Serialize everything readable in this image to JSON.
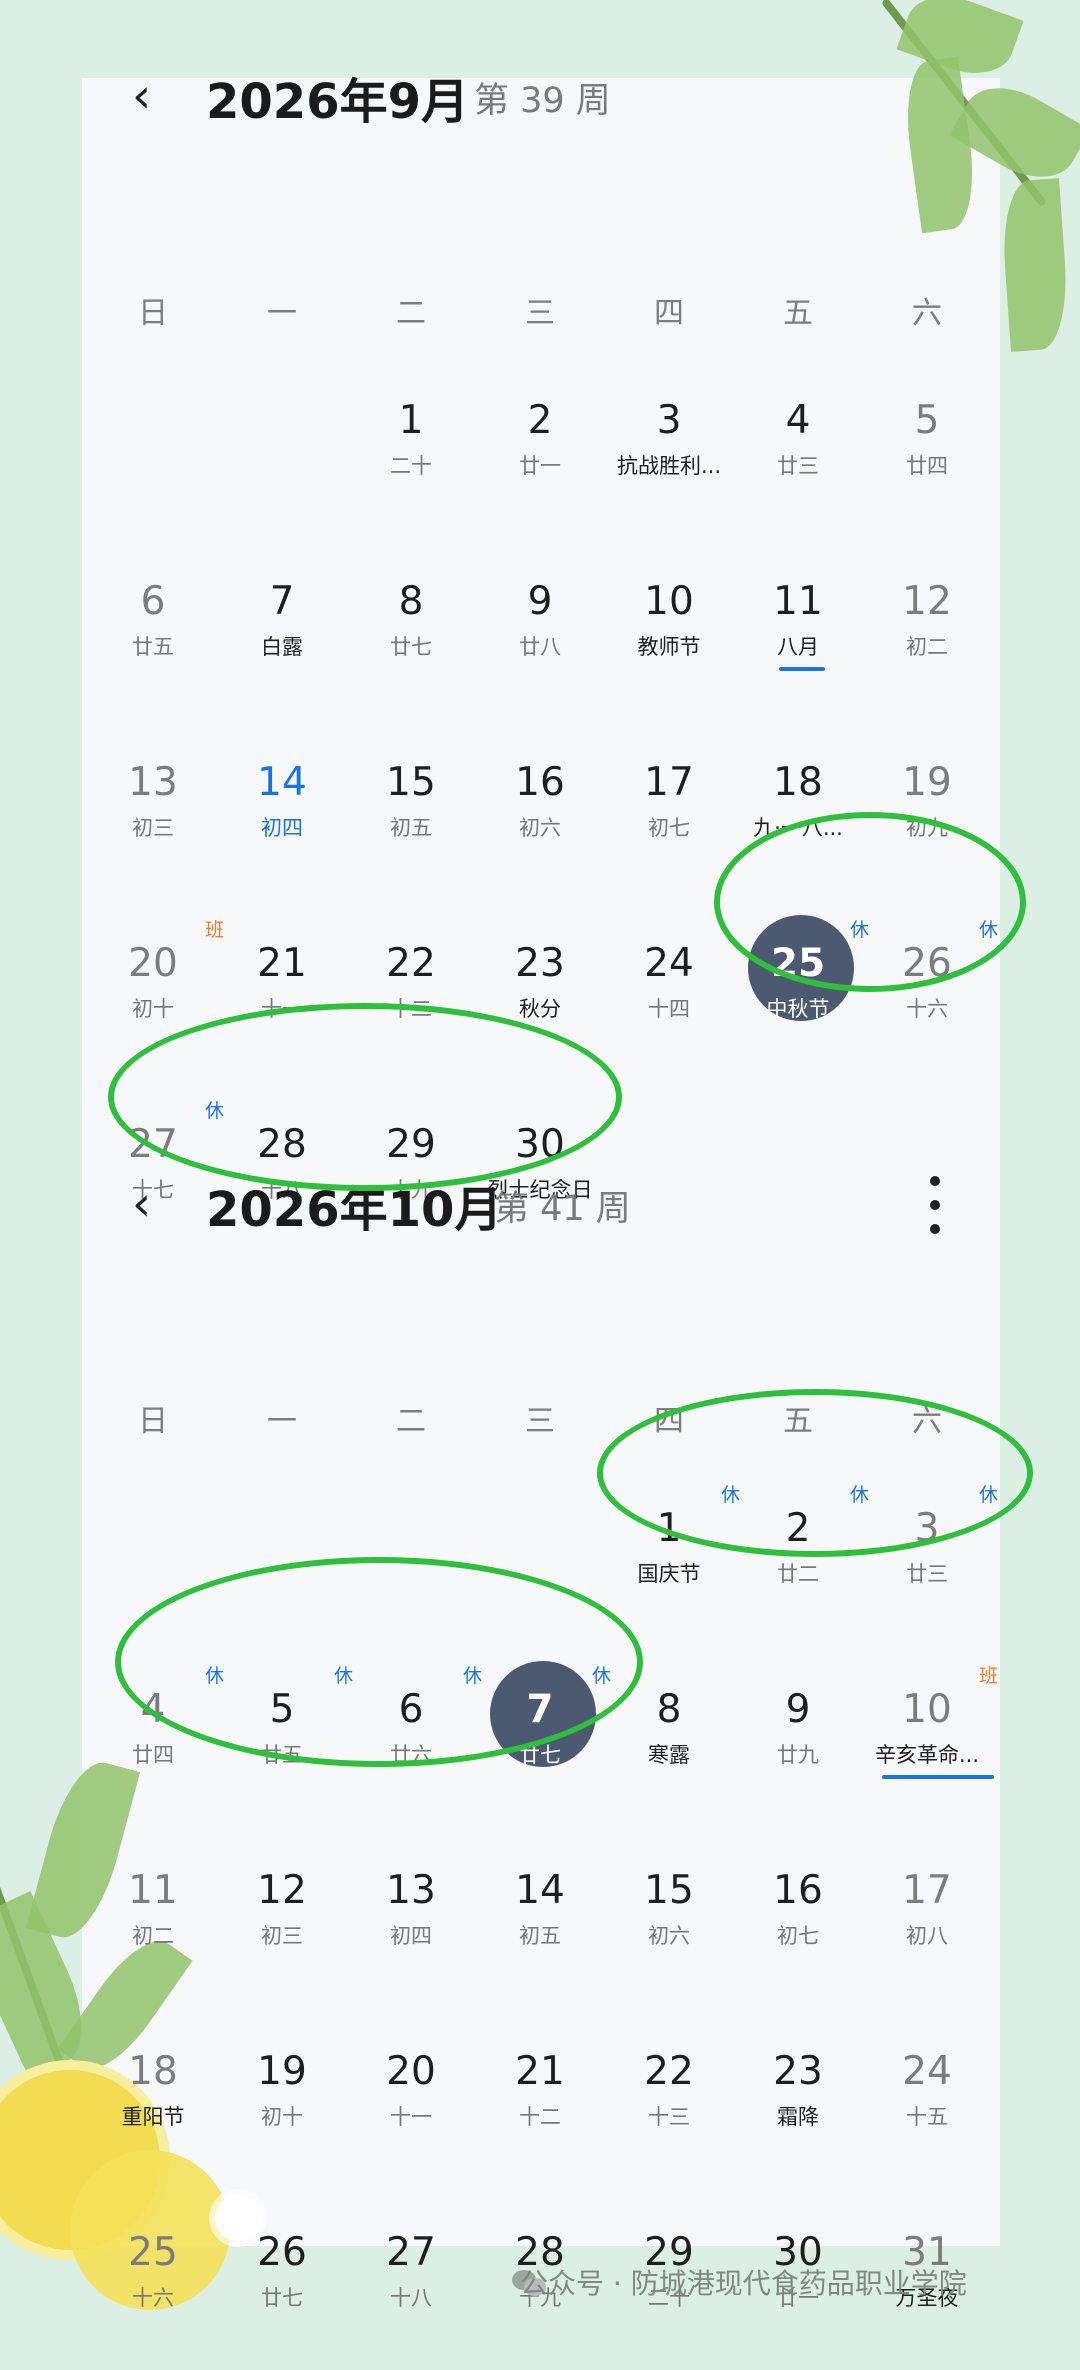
{
  "weekday_headers": [
    "日",
    "一",
    "二",
    "三",
    "四",
    "五",
    "六"
  ],
  "months": [
    {
      "title": "2026年9月",
      "week_label": "第 39 周",
      "show_more": false,
      "weeks": [
        [
          null,
          null,
          {
            "day": "1",
            "lunar": "二十"
          },
          {
            "day": "2",
            "lunar": "廿一"
          },
          {
            "day": "3",
            "lunar": "抗战胜利...",
            "lunar_dark": true
          },
          {
            "day": "4",
            "lunar": "廿三"
          },
          {
            "day": "5",
            "lunar": "廿四"
          }
        ],
        [
          {
            "day": "6",
            "lunar": "廿五"
          },
          {
            "day": "7",
            "lunar": "白露",
            "lunar_dark": true
          },
          {
            "day": "8",
            "lunar": "廿七"
          },
          {
            "day": "9",
            "lunar": "廿八"
          },
          {
            "day": "10",
            "lunar": "教师节",
            "lunar_dark": true
          },
          {
            "day": "11",
            "lunar": "八月",
            "lunar_dark": true,
            "underline": true
          },
          {
            "day": "12",
            "lunar": "初二"
          }
        ],
        [
          {
            "day": "13",
            "lunar": "初三"
          },
          {
            "day": "14",
            "lunar": "初四",
            "today": true
          },
          {
            "day": "15",
            "lunar": "初五"
          },
          {
            "day": "16",
            "lunar": "初六"
          },
          {
            "day": "17",
            "lunar": "初七"
          },
          {
            "day": "18",
            "lunar": "九·一八...",
            "lunar_dark": true
          },
          {
            "day": "19",
            "lunar": "初九"
          }
        ],
        [
          {
            "day": "20",
            "lunar": "初十",
            "badge": "班",
            "badge_type": "work"
          },
          {
            "day": "21",
            "lunar": "十一"
          },
          {
            "day": "22",
            "lunar": "十二"
          },
          {
            "day": "23",
            "lunar": "秋分",
            "lunar_dark": true
          },
          {
            "day": "24",
            "lunar": "十四"
          },
          {
            "day": "25",
            "lunar": "中秋节",
            "selected": true,
            "badge": "休",
            "badge_type": "rest"
          },
          {
            "day": "26",
            "lunar": "十六",
            "badge": "休",
            "badge_type": "rest"
          }
        ],
        [
          {
            "day": "27",
            "lunar": "十七",
            "badge": "休",
            "badge_type": "rest"
          },
          {
            "day": "28",
            "lunar": "十八"
          },
          {
            "day": "29",
            "lunar": "十九"
          },
          {
            "day": "30",
            "lunar": "烈士纪念日",
            "lunar_dark": true
          },
          null,
          null,
          null
        ]
      ]
    },
    {
      "title": "2026年10月",
      "week_label": "第 41 周",
      "show_more": true,
      "weeks": [
        [
          null,
          null,
          null,
          null,
          {
            "day": "1",
            "lunar": "国庆节",
            "lunar_dark": true,
            "badge": "休",
            "badge_type": "rest"
          },
          {
            "day": "2",
            "lunar": "廿二",
            "badge": "休",
            "badge_type": "rest"
          },
          {
            "day": "3",
            "lunar": "廿三",
            "badge": "休",
            "badge_type": "rest"
          }
        ],
        [
          {
            "day": "4",
            "lunar": "廿四",
            "badge": "休",
            "badge_type": "rest"
          },
          {
            "day": "5",
            "lunar": "廿五",
            "badge": "休",
            "badge_type": "rest"
          },
          {
            "day": "6",
            "lunar": "廿六",
            "badge": "休",
            "badge_type": "rest"
          },
          {
            "day": "7",
            "lunar": "廿七",
            "selected": true,
            "badge": "休",
            "badge_type": "rest"
          },
          {
            "day": "8",
            "lunar": "寒露",
            "lunar_dark": true
          },
          {
            "day": "9",
            "lunar": "廿九"
          },
          {
            "day": "10",
            "lunar": "辛亥革命...",
            "lunar_dark": true,
            "underline": true,
            "badge": "班",
            "badge_type": "work"
          }
        ],
        [
          {
            "day": "11",
            "lunar": "初二"
          },
          {
            "day": "12",
            "lunar": "初三"
          },
          {
            "day": "13",
            "lunar": "初四"
          },
          {
            "day": "14",
            "lunar": "初五"
          },
          {
            "day": "15",
            "lunar": "初六"
          },
          {
            "day": "16",
            "lunar": "初七"
          },
          {
            "day": "17",
            "lunar": "初八"
          }
        ],
        [
          {
            "day": "18",
            "lunar": "重阳节",
            "lunar_dark": true
          },
          {
            "day": "19",
            "lunar": "初十"
          },
          {
            "day": "20",
            "lunar": "十一"
          },
          {
            "day": "21",
            "lunar": "十二"
          },
          {
            "day": "22",
            "lunar": "十三"
          },
          {
            "day": "23",
            "lunar": "霜降",
            "lunar_dark": true
          },
          {
            "day": "24",
            "lunar": "十五"
          }
        ],
        [
          {
            "day": "25",
            "lunar": "十六"
          },
          {
            "day": "26",
            "lunar": "廿七"
          },
          {
            "day": "27",
            "lunar": "十八"
          },
          {
            "day": "28",
            "lunar": "十九"
          },
          {
            "day": "29",
            "lunar": "二十"
          },
          {
            "day": "30",
            "lunar": "廿一"
          },
          {
            "day": "31",
            "lunar": "万圣夜",
            "lunar_dark": true
          }
        ]
      ]
    }
  ],
  "footer": {
    "text": "公众号 · 防城港现代食药品职业学院",
    "icon": "wechat-icon"
  },
  "colors": {
    "accent": "#1a73e8",
    "selected": "#4b5a70",
    "highlight_ring": "#2fbf3c",
    "work_badge": "#f07b2e"
  }
}
